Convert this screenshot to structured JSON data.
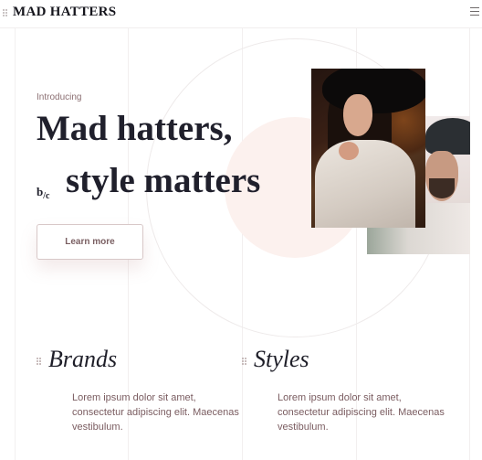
{
  "header": {
    "brand": "MAD HATTERS",
    "menu_icon": "hamburger-menu-icon",
    "drag_icon": "drag-handle-icon"
  },
  "hero": {
    "intro": "Introducing",
    "headline_line1": "Mad hatters,",
    "bc_prefix_b": "b",
    "bc_prefix_c": "/c",
    "headline_line2": "style matters",
    "button_label": "Learn more"
  },
  "sections": [
    {
      "title": "Brands",
      "text": "Lorem ipsum dolor sit amet, consectetur adipiscing elit. Maecenas vestibulum."
    },
    {
      "title": "Styles",
      "text": "Lorem ipsum dolor sit amet, consectetur adipiscing elit. Maecenas vestibulum."
    }
  ],
  "colors": {
    "accent_text": "#7a5c60",
    "blush": "#fcf1ee",
    "heading": "#20202c"
  }
}
